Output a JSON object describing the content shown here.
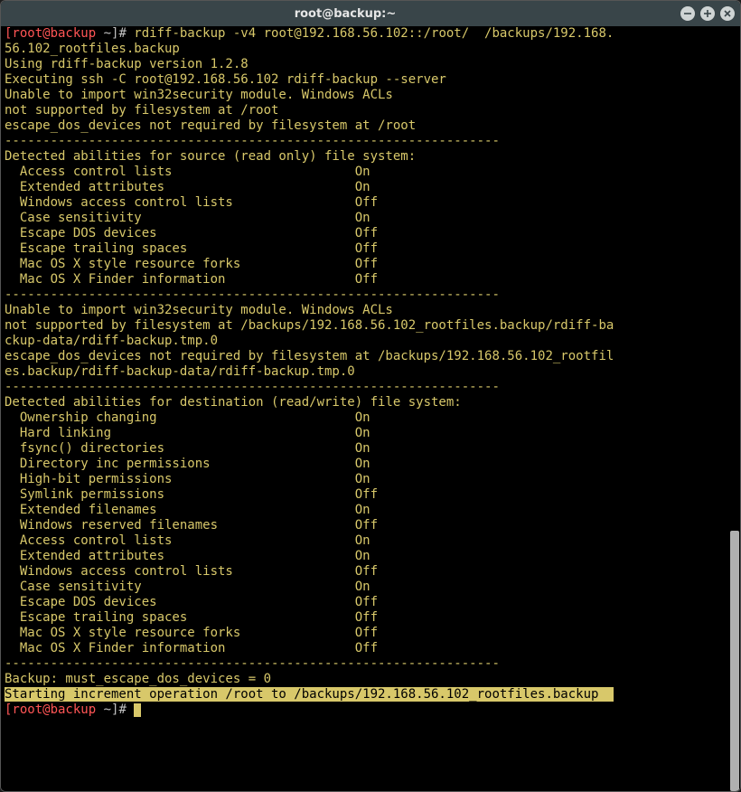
{
  "window": {
    "title": "root@backup:~"
  },
  "prompt": {
    "user_host": "[root@backup ~]#",
    "command": "rdiff-backup -v4 root@192.168.56.102::/root/  /backups/192.168.56.102_rootfiles.backup"
  },
  "output": {
    "version": "Using rdiff-backup version 1.2.8",
    "exec_ssh": "Executing ssh -C root@192.168.56.102 rdiff-backup --server",
    "win32_1a": "Unable to import win32security module. Windows ACLs",
    "win32_1b": "not supported by filesystem at /root",
    "escape_1": "escape_dos_devices not required by filesystem at /root",
    "dash": "-----------------------------------------------------------------",
    "src_header": "Detected abilities for source (read only) file system:",
    "src_abilities": [
      {
        "name": "Access control lists",
        "value": "On"
      },
      {
        "name": "Extended attributes",
        "value": "On"
      },
      {
        "name": "Windows access control lists",
        "value": "Off"
      },
      {
        "name": "Case sensitivity",
        "value": "On"
      },
      {
        "name": "Escape DOS devices",
        "value": "Off"
      },
      {
        "name": "Escape trailing spaces",
        "value": "Off"
      },
      {
        "name": "Mac OS X style resource forks",
        "value": "Off"
      },
      {
        "name": "Mac OS X Finder information",
        "value": "Off"
      }
    ],
    "win32_2a": "Unable to import win32security module. Windows ACLs",
    "win32_2b": "not supported by filesystem at /backups/192.168.56.102_rootfiles.backup/rdiff-backup-data/rdiff-backup.tmp.0",
    "escape_2": "escape_dos_devices not required by filesystem at /backups/192.168.56.102_rootfiles.backup/rdiff-backup-data/rdiff-backup.tmp.0",
    "dst_header": "Detected abilities for destination (read/write) file system:",
    "dst_abilities": [
      {
        "name": "Ownership changing",
        "value": "On"
      },
      {
        "name": "Hard linking",
        "value": "On"
      },
      {
        "name": "fsync() directories",
        "value": "On"
      },
      {
        "name": "Directory inc permissions",
        "value": "On"
      },
      {
        "name": "High-bit permissions",
        "value": "On"
      },
      {
        "name": "Symlink permissions",
        "value": "Off"
      },
      {
        "name": "Extended filenames",
        "value": "On"
      },
      {
        "name": "Windows reserved filenames",
        "value": "Off"
      },
      {
        "name": "Access control lists",
        "value": "On"
      },
      {
        "name": "Extended attributes",
        "value": "On"
      },
      {
        "name": "Windows access control lists",
        "value": "Off"
      },
      {
        "name": "Case sensitivity",
        "value": "On"
      },
      {
        "name": "Escape DOS devices",
        "value": "Off"
      },
      {
        "name": "Escape trailing spaces",
        "value": "Off"
      },
      {
        "name": "Mac OS X style resource forks",
        "value": "Off"
      },
      {
        "name": "Mac OS X Finder information",
        "value": "Off"
      }
    ],
    "backup_escape": "Backup: must_escape_dos_devices = 0",
    "start_op": "Starting increment operation /root to /backups/192.168.56.102_rootfiles.backup"
  },
  "layout": {
    "terminal_cols": 80,
    "ability_value_col": 46
  },
  "scrollbar": {
    "thumb_top_pct": 66,
    "thumb_height_pct": 34
  }
}
